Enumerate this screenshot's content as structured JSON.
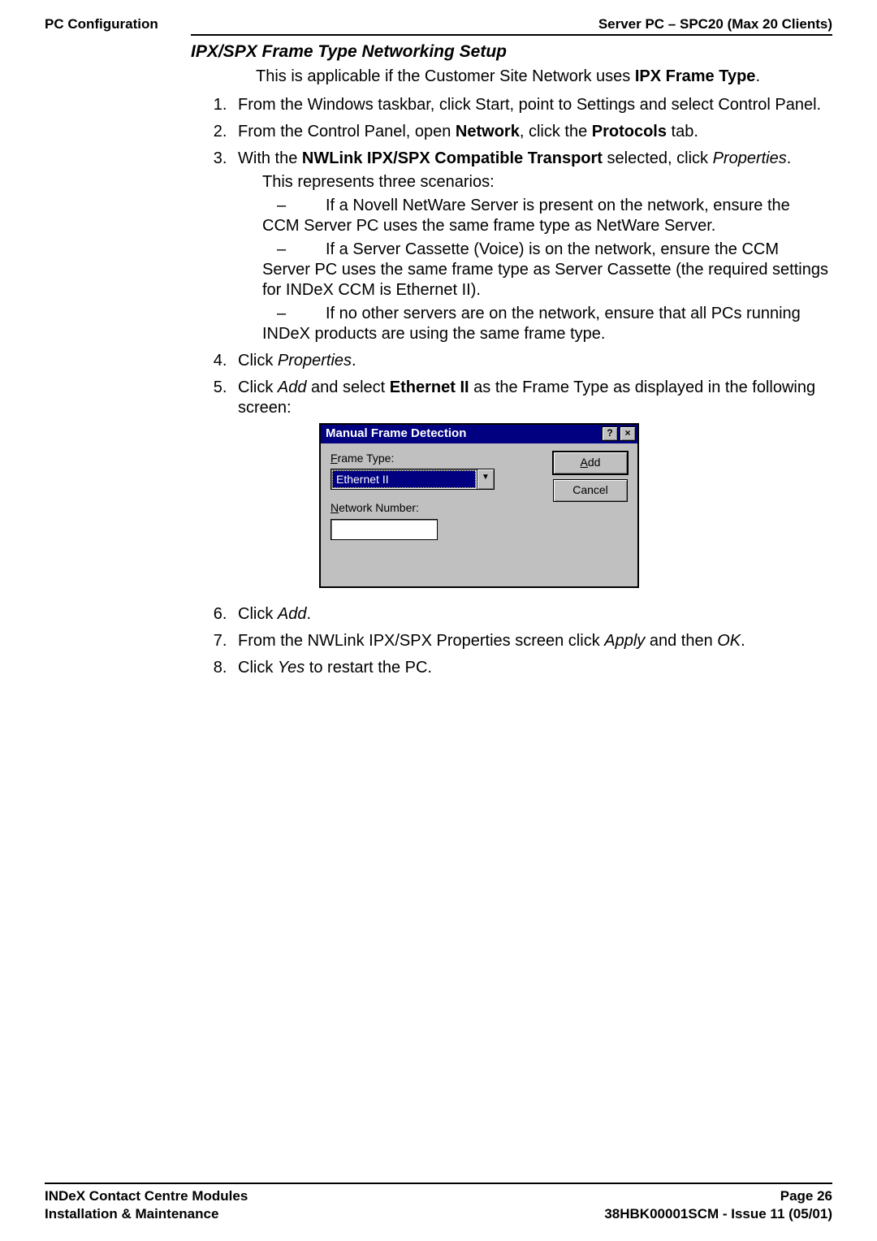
{
  "header": {
    "left": "PC Configuration",
    "right": "Server PC – SPC20 (Max 20 Clients)"
  },
  "section_title": "IPX/SPX Frame Type Networking Setup",
  "intro": {
    "pre": "This is applicable if the Customer Site Network uses ",
    "bold": "IPX Frame Type",
    "post": "."
  },
  "steps": {
    "s1": "From the Windows taskbar, click Start, point to Settings and select Control Panel.",
    "s2": {
      "a": "From the Control Panel, open ",
      "b": "Network",
      "c": ", click the ",
      "d": "Protocols",
      "e": " tab."
    },
    "s3": {
      "a": "With the ",
      "b": "NWLink IPX/SPX Compatible Transport",
      "c": " selected, click ",
      "d": "Properties",
      "e": "."
    },
    "s3_sub_intro": "This represents three scenarios:",
    "s3_d1_lead": "If a Novell NetWare Server is present on the network, ensure the",
    "s3_d1_cont": "CCM Server PC uses the same frame type as NetWare Server.",
    "s3_d2_lead": "If a Server Cassette (Voice) is on the network, ensure the CCM",
    "s3_d2_cont": "Server PC uses the same frame type as Server Cassette (the required settings for INDeX CCM is Ethernet II).",
    "s3_d3_lead": "If no other servers are on the network, ensure that all PCs running",
    "s3_d3_cont": "INDeX products are using the same frame type.",
    "s4": {
      "a": "Click ",
      "b": "Properties",
      "c": "."
    },
    "s5": {
      "a": "Click ",
      "b": "Add",
      "c": " and select ",
      "d": "Ethernet II",
      "e": " as the Frame Type as displayed in the following screen:"
    },
    "s6": {
      "a": "Click ",
      "b": "Add",
      "c": "."
    },
    "s7": {
      "a": "From the NWLink IPX/SPX Properties screen click ",
      "b": "Apply",
      "c": " and then ",
      "d": "OK",
      "e": "."
    },
    "s8": {
      "a": "Click ",
      "b": "Yes",
      "c": " to restart the PC."
    }
  },
  "dialog": {
    "title": "Manual Frame Detection",
    "help_glyph": "?",
    "close_glyph": "×",
    "frame_type_label_pre": "F",
    "frame_type_label_post": "rame Type:",
    "frame_type_value": "Ethernet II",
    "dropdown_glyph": "▼",
    "network_number_label_pre": "N",
    "network_number_label_post": "etwork Number:",
    "network_number_value": "",
    "add_btn_pre": "A",
    "add_btn_post": "dd",
    "cancel_btn": "Cancel"
  },
  "chart_data": {
    "type": "table",
    "title": "Manual Frame Detection dialog fields",
    "rows": [
      {
        "field": "Frame Type",
        "value": "Ethernet II"
      },
      {
        "field": "Network Number",
        "value": ""
      }
    ],
    "buttons": [
      "Add",
      "Cancel"
    ]
  },
  "footer": {
    "left1": "INDeX Contact Centre Modules",
    "left2": "Installation & Maintenance",
    "right1": "Page 26",
    "right2": "38HBK00001SCM - Issue 11 (05/01)"
  }
}
